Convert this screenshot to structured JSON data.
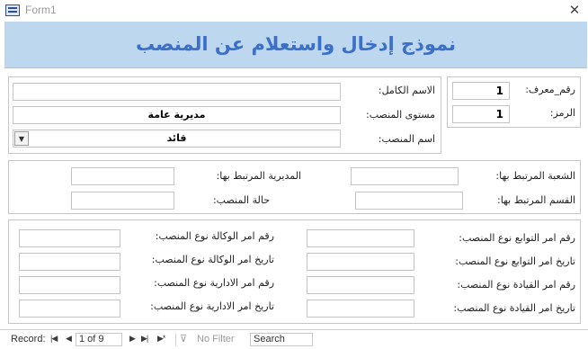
{
  "window": {
    "title": "Form1"
  },
  "header": {
    "title": "نموذج إدخال واستعلام عن المنصب"
  },
  "section1": {
    "id_label": "رقم_معرف:",
    "id_value": "1",
    "code_label": "الرمز:",
    "code_value": "1",
    "full_name_label": "الاسم الكامل:",
    "full_name_value": "",
    "level_label": "مستوى المنصب:",
    "level_value": "مديرية عامة",
    "position_name_label": "اسم المنصب:",
    "position_name_value": "قائد"
  },
  "section2": {
    "branch_label": "الشعبة المرتبط بها:",
    "directorate_label": "المديرية المرتبط بها:",
    "department_label": "القسم المرتبط بها:",
    "status_label": "حالة المنصب:"
  },
  "section3": {
    "affiliates_order_no_label": "رقم امر التوابع نوع المنصب:",
    "agency_order_no_label": "رقم امر الوكالة نوع المنصب:",
    "affiliates_order_date_label": "تاريخ امر التوابع نوع المنصب:",
    "agency_order_date_label": "تاريخ امر الوكالة نوع المنصب:",
    "command_order_no_label": "رقم امر القيادة نوع المنصب:",
    "admin_order_no_label": "رقم امر الادارية نوع المنصب:",
    "command_order_date_label": "تاريخ امر القيادة نوع المنصب:",
    "admin_order_date_label": "تاريخ امر الادارية نوع المنصب:"
  },
  "navigator": {
    "record_label": "Record:",
    "record_position": "1 of 9",
    "no_filter_label": "No Filter",
    "search_placeholder": "Search"
  }
}
